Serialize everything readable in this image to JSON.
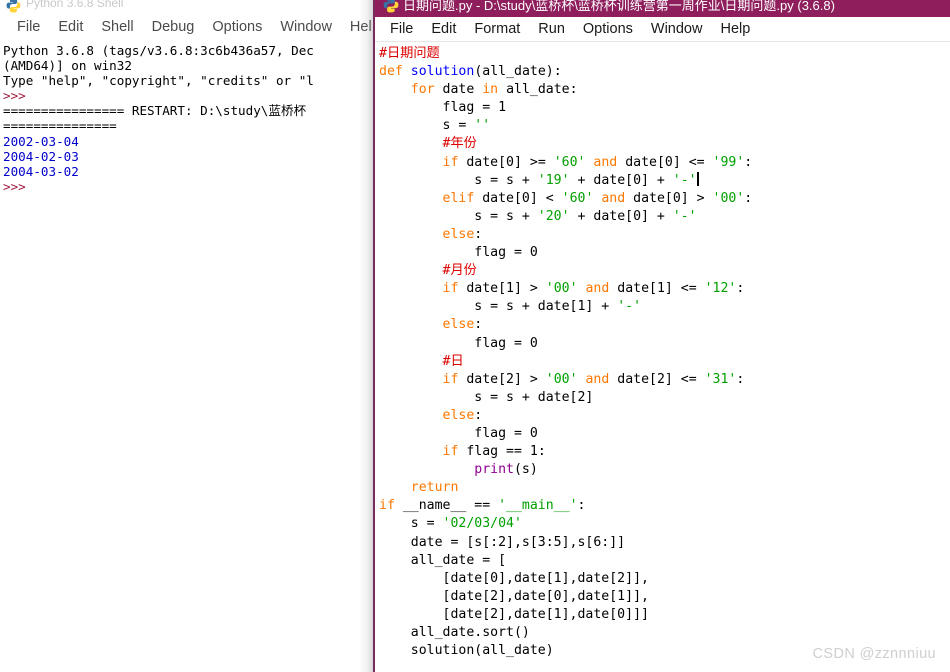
{
  "shell_window": {
    "title": "Python 3.6.8 Shell",
    "icon": "python-logo-icon",
    "menu": [
      {
        "label": "File"
      },
      {
        "label": "Edit"
      },
      {
        "label": "Shell"
      },
      {
        "label": "Debug"
      },
      {
        "label": "Options"
      },
      {
        "label": "Window"
      },
      {
        "label": "Hel"
      }
    ],
    "lines": [
      {
        "cls": "c-black",
        "text": "Python 3.6.8 (tags/v3.6.8:3c6b436a57, Dec"
      },
      {
        "cls": "c-black",
        "text": "(AMD64)] on win32"
      },
      {
        "cls": "c-black",
        "text": "Type \"help\", \"copyright\", \"credits\" or \"l"
      },
      {
        "cls": "c-prompt",
        "text": ">>>"
      },
      {
        "cls": "c-black",
        "text": "================ RESTART: D:\\study\\蓝桥杯"
      },
      {
        "cls": "c-black",
        "text": "==============="
      },
      {
        "cls": "c-out",
        "text": "2002-03-04"
      },
      {
        "cls": "c-out",
        "text": "2004-02-03"
      },
      {
        "cls": "c-out",
        "text": "2004-03-02"
      },
      {
        "cls": "c-prompt",
        "text": ">>>"
      }
    ]
  },
  "editor_window": {
    "title": "日期问题.py - D:\\study\\蓝桥杯\\蓝桥杯训练营第一周作业\\日期问题.py (3.6.8)",
    "icon": "python-logo-icon",
    "menu": [
      {
        "label": "File"
      },
      {
        "label": "Edit"
      },
      {
        "label": "Format"
      },
      {
        "label": "Run"
      },
      {
        "label": "Options"
      },
      {
        "label": "Window"
      },
      {
        "label": "Help"
      }
    ],
    "code": [
      [
        {
          "c": "cmt",
          "t": "#日期问题"
        }
      ],
      [
        {
          "c": "kw",
          "t": "def"
        },
        {
          "c": "plain",
          "t": " "
        },
        {
          "c": "def",
          "t": "solution"
        },
        {
          "c": "plain",
          "t": "(all_date):"
        }
      ],
      [
        {
          "c": "plain",
          "t": "    "
        },
        {
          "c": "kw",
          "t": "for"
        },
        {
          "c": "plain",
          "t": " date "
        },
        {
          "c": "kw",
          "t": "in"
        },
        {
          "c": "plain",
          "t": " all_date:"
        }
      ],
      [
        {
          "c": "plain",
          "t": "        flag = 1"
        }
      ],
      [
        {
          "c": "plain",
          "t": "        s = "
        },
        {
          "c": "str",
          "t": "''"
        }
      ],
      [
        {
          "c": "plain",
          "t": "        "
        },
        {
          "c": "cmt",
          "t": "#年份"
        }
      ],
      [
        {
          "c": "plain",
          "t": "        "
        },
        {
          "c": "kw",
          "t": "if"
        },
        {
          "c": "plain",
          "t": " date[0] >= "
        },
        {
          "c": "str",
          "t": "'60'"
        },
        {
          "c": "plain",
          "t": " "
        },
        {
          "c": "kw",
          "t": "and"
        },
        {
          "c": "plain",
          "t": " date[0] <= "
        },
        {
          "c": "str",
          "t": "'99'"
        },
        {
          "c": "plain",
          "t": ":"
        }
      ],
      [
        {
          "c": "plain",
          "t": "            s = s + "
        },
        {
          "c": "str",
          "t": "'19'"
        },
        {
          "c": "plain",
          "t": " + date[0] + "
        },
        {
          "c": "str",
          "t": "'-'"
        },
        {
          "c": "caret",
          "t": ""
        }
      ],
      [
        {
          "c": "plain",
          "t": "        "
        },
        {
          "c": "kw",
          "t": "elif"
        },
        {
          "c": "plain",
          "t": " date[0] < "
        },
        {
          "c": "str",
          "t": "'60'"
        },
        {
          "c": "plain",
          "t": " "
        },
        {
          "c": "kw",
          "t": "and"
        },
        {
          "c": "plain",
          "t": " date[0] > "
        },
        {
          "c": "str",
          "t": "'00'"
        },
        {
          "c": "plain",
          "t": ":"
        }
      ],
      [
        {
          "c": "plain",
          "t": "            s = s + "
        },
        {
          "c": "str",
          "t": "'20'"
        },
        {
          "c": "plain",
          "t": " + date[0] + "
        },
        {
          "c": "str",
          "t": "'-'"
        }
      ],
      [
        {
          "c": "plain",
          "t": "        "
        },
        {
          "c": "kw",
          "t": "else"
        },
        {
          "c": "plain",
          "t": ":"
        }
      ],
      [
        {
          "c": "plain",
          "t": "            flag = 0"
        }
      ],
      [
        {
          "c": "plain",
          "t": "        "
        },
        {
          "c": "cmt",
          "t": "#月份"
        }
      ],
      [
        {
          "c": "plain",
          "t": "        "
        },
        {
          "c": "kw",
          "t": "if"
        },
        {
          "c": "plain",
          "t": " date[1] > "
        },
        {
          "c": "str",
          "t": "'00'"
        },
        {
          "c": "plain",
          "t": " "
        },
        {
          "c": "kw",
          "t": "and"
        },
        {
          "c": "plain",
          "t": " date[1] <= "
        },
        {
          "c": "str",
          "t": "'12'"
        },
        {
          "c": "plain",
          "t": ":"
        }
      ],
      [
        {
          "c": "plain",
          "t": "            s = s + date[1] + "
        },
        {
          "c": "str",
          "t": "'-'"
        }
      ],
      [
        {
          "c": "plain",
          "t": "        "
        },
        {
          "c": "kw",
          "t": "else"
        },
        {
          "c": "plain",
          "t": ":"
        }
      ],
      [
        {
          "c": "plain",
          "t": "            flag = 0"
        }
      ],
      [
        {
          "c": "plain",
          "t": "        "
        },
        {
          "c": "cmt",
          "t": "#日"
        }
      ],
      [
        {
          "c": "plain",
          "t": "        "
        },
        {
          "c": "kw",
          "t": "if"
        },
        {
          "c": "plain",
          "t": " date[2] > "
        },
        {
          "c": "str",
          "t": "'00'"
        },
        {
          "c": "plain",
          "t": " "
        },
        {
          "c": "kw",
          "t": "and"
        },
        {
          "c": "plain",
          "t": " date[2] <= "
        },
        {
          "c": "str",
          "t": "'31'"
        },
        {
          "c": "plain",
          "t": ":"
        }
      ],
      [
        {
          "c": "plain",
          "t": "            s = s + date[2]"
        }
      ],
      [
        {
          "c": "plain",
          "t": "        "
        },
        {
          "c": "kw",
          "t": "else"
        },
        {
          "c": "plain",
          "t": ":"
        }
      ],
      [
        {
          "c": "plain",
          "t": "            flag = 0"
        }
      ],
      [
        {
          "c": "plain",
          "t": "        "
        },
        {
          "c": "kw",
          "t": "if"
        },
        {
          "c": "plain",
          "t": " flag == 1:"
        }
      ],
      [
        {
          "c": "plain",
          "t": "            "
        },
        {
          "c": "builtin",
          "t": "print"
        },
        {
          "c": "plain",
          "t": "(s)"
        }
      ],
      [
        {
          "c": "plain",
          "t": "    "
        },
        {
          "c": "kw",
          "t": "return"
        }
      ],
      [
        {
          "c": "kw",
          "t": "if"
        },
        {
          "c": "plain",
          "t": " __name__ == "
        },
        {
          "c": "str",
          "t": "'__main__'"
        },
        {
          "c": "plain",
          "t": ":"
        }
      ],
      [
        {
          "c": "plain",
          "t": "    s = "
        },
        {
          "c": "str",
          "t": "'02/03/04'"
        }
      ],
      [
        {
          "c": "plain",
          "t": "    date = [s[:2],s[3:5],s[6:]]"
        }
      ],
      [
        {
          "c": "plain",
          "t": "    all_date = ["
        }
      ],
      [
        {
          "c": "plain",
          "t": "        [date[0],date[1],date[2]],"
        }
      ],
      [
        {
          "c": "plain",
          "t": "        [date[2],date[0],date[1]],"
        }
      ],
      [
        {
          "c": "plain",
          "t": "        [date[2],date[1],date[0]]]"
        }
      ],
      [
        {
          "c": "plain",
          "t": "    all_date.sort()"
        }
      ],
      [
        {
          "c": "plain",
          "t": "    solution(all_date)"
        }
      ]
    ]
  },
  "watermark": {
    "text": "CSDN @zznnniuu"
  },
  "colors": {
    "title_bar": "#8e1e5c",
    "window_border": "#7b2a5e",
    "keyword": "#ff7700",
    "definition": "#0000ff",
    "string": "#00a000",
    "comment": "#dd0000",
    "builtin": "#900090",
    "shell_prompt": "#a0173c",
    "shell_output": "#0000cc"
  }
}
